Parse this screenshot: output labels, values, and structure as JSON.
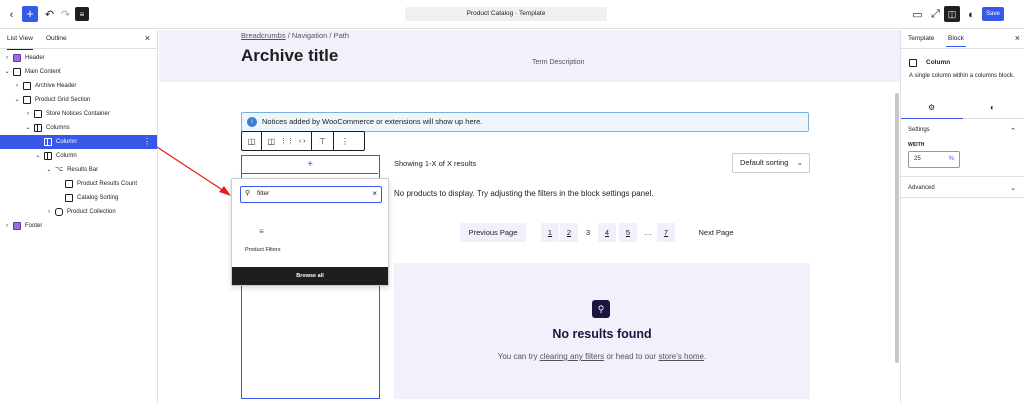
{
  "topbar": {
    "back_icon": "chevron-left-icon",
    "add_icon": "plus-icon",
    "undo_icon": "undo-icon",
    "redo_icon": "redo-icon",
    "list_icon": "document-overview-icon",
    "document_title": "Product Catalog · Template",
    "save_label": "Save",
    "accent": "#3858e9"
  },
  "left_panel": {
    "tabs": [
      "List View",
      "Outline"
    ],
    "active_tab": "List View",
    "tree": [
      {
        "label": "Header",
        "depth": 0,
        "expanded": false
      },
      {
        "label": "Main Content",
        "depth": 0,
        "expanded": true
      },
      {
        "label": "Archive Header",
        "depth": 1,
        "expanded": false
      },
      {
        "label": "Product Grid Section",
        "depth": 1,
        "expanded": true
      },
      {
        "label": "Store Notices Container",
        "depth": 2,
        "expanded": false
      },
      {
        "label": "Columns",
        "depth": 2,
        "expanded": true
      },
      {
        "label": "Column",
        "depth": 3,
        "expanded": null,
        "selected": true
      },
      {
        "label": "Column",
        "depth": 3,
        "expanded": true
      },
      {
        "label": "Results Bar",
        "depth": 4,
        "expanded": true
      },
      {
        "label": "Product Results Count",
        "depth": 5,
        "expanded": null
      },
      {
        "label": "Catalog Sorting",
        "depth": 5,
        "expanded": null
      },
      {
        "label": "Product Collection",
        "depth": 4,
        "expanded": false
      },
      {
        "label": "Footer",
        "depth": 0,
        "expanded": false
      }
    ]
  },
  "canvas": {
    "breadcrumbs": [
      "Breadcrumbs",
      "Navigation",
      "Path"
    ],
    "archive_title": "Archive title",
    "term_description": "Term Description",
    "notice": "Notices added by WooCommerce or extensions will show up here.",
    "showing": "Showing 1-X of X results",
    "sorting": "Default sorting",
    "no_products": "No products to display. Try adjusting the filters in the block settings panel.",
    "pagination": {
      "previous": "Previous Page",
      "pages": [
        "1",
        "2",
        "3",
        "4",
        "5",
        "…",
        "7"
      ],
      "current": "3",
      "next": "Next Page"
    },
    "no_results": {
      "title": "No results found",
      "text_before": "You can try ",
      "link1": "clearing any filters",
      "text_middle": " or head to our ",
      "link2": "store's home",
      "text_after": "."
    }
  },
  "inserter": {
    "search_value": "filter",
    "result_label": "Product Filters",
    "result_icon": "filter-icon",
    "browse_all": "Browse all"
  },
  "right_panel": {
    "tabs": [
      "Template",
      "Block"
    ],
    "active_tab": "Block",
    "block_name": "Column",
    "block_description": "A single column within a columns block.",
    "settings_title": "Settings",
    "width_label": "WIDTH",
    "width_value": "25",
    "width_unit": "%",
    "advanced_label": "Advanced"
  }
}
